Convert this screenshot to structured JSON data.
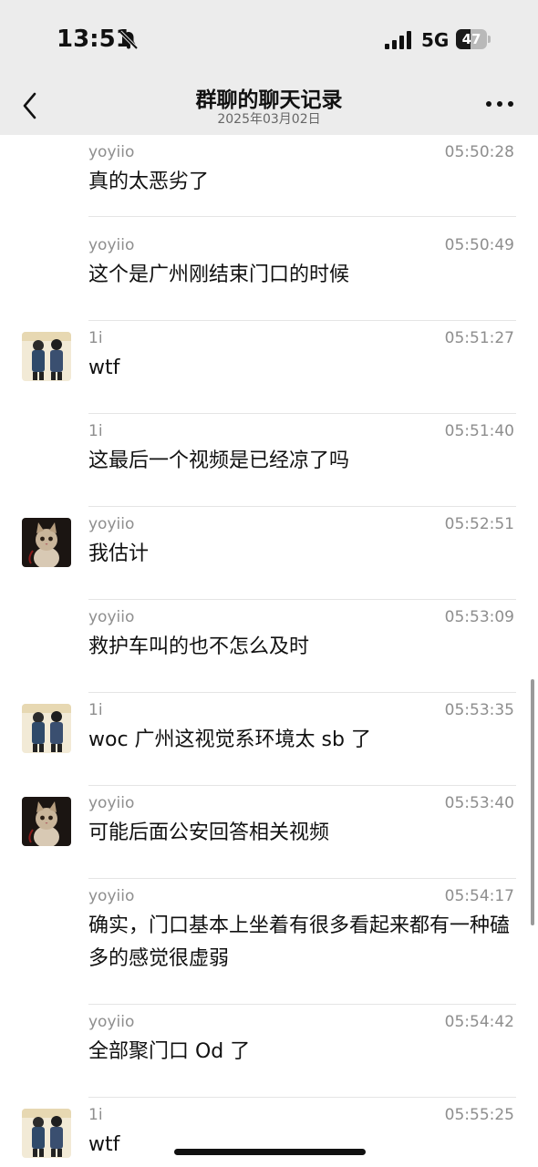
{
  "status_bar": {
    "time": "13:51",
    "network": "5G",
    "battery_text": "47",
    "battery_level_percent": 47,
    "icons": [
      "bell-slash-icon",
      "signal-icon",
      "battery-icon"
    ]
  },
  "header": {
    "title": "群聊的聊天记录",
    "subtitle": "2025年03月02日",
    "icons": [
      "back-chevron-icon",
      "more-icon"
    ]
  },
  "messages": [
    {
      "sender": "yoyiio",
      "time": "05:50:28",
      "text": "真的太恶劣了",
      "avatar": ""
    },
    {
      "sender": "yoyiio",
      "time": "05:50:49",
      "text": "这个是广州刚结束门口的时候",
      "avatar": ""
    },
    {
      "sender": "1i",
      "time": "05:51:27",
      "text": "wtf",
      "avatar": "two-people-avatar"
    },
    {
      "sender": "1i",
      "time": "05:51:40",
      "text": "这最后一个视频是已经凉了吗",
      "avatar": ""
    },
    {
      "sender": "yoyiio",
      "time": "05:52:51",
      "text": "我估计",
      "avatar": "cat-avatar"
    },
    {
      "sender": "yoyiio",
      "time": "05:53:09",
      "text": "救护车叫的也不怎么及时",
      "avatar": ""
    },
    {
      "sender": "1i",
      "time": "05:53:35",
      "text": "woc 广州这视觉系环境太 sb 了",
      "avatar": "two-people-avatar"
    },
    {
      "sender": "yoyiio",
      "time": "05:53:40",
      "text": "可能后面公安回答相关视频",
      "avatar": "cat-avatar"
    },
    {
      "sender": "yoyiio",
      "time": "05:54:17",
      "text": "确实，门口基本上坐着有很多看起来都有一种磕多的感觉很虚弱",
      "avatar": ""
    },
    {
      "sender": "yoyiio",
      "time": "05:54:42",
      "text": "全部聚门口 Od 了",
      "avatar": ""
    },
    {
      "sender": "1i",
      "time": "05:55:25",
      "text": "wtf",
      "avatar": "two-people-avatar"
    }
  ]
}
